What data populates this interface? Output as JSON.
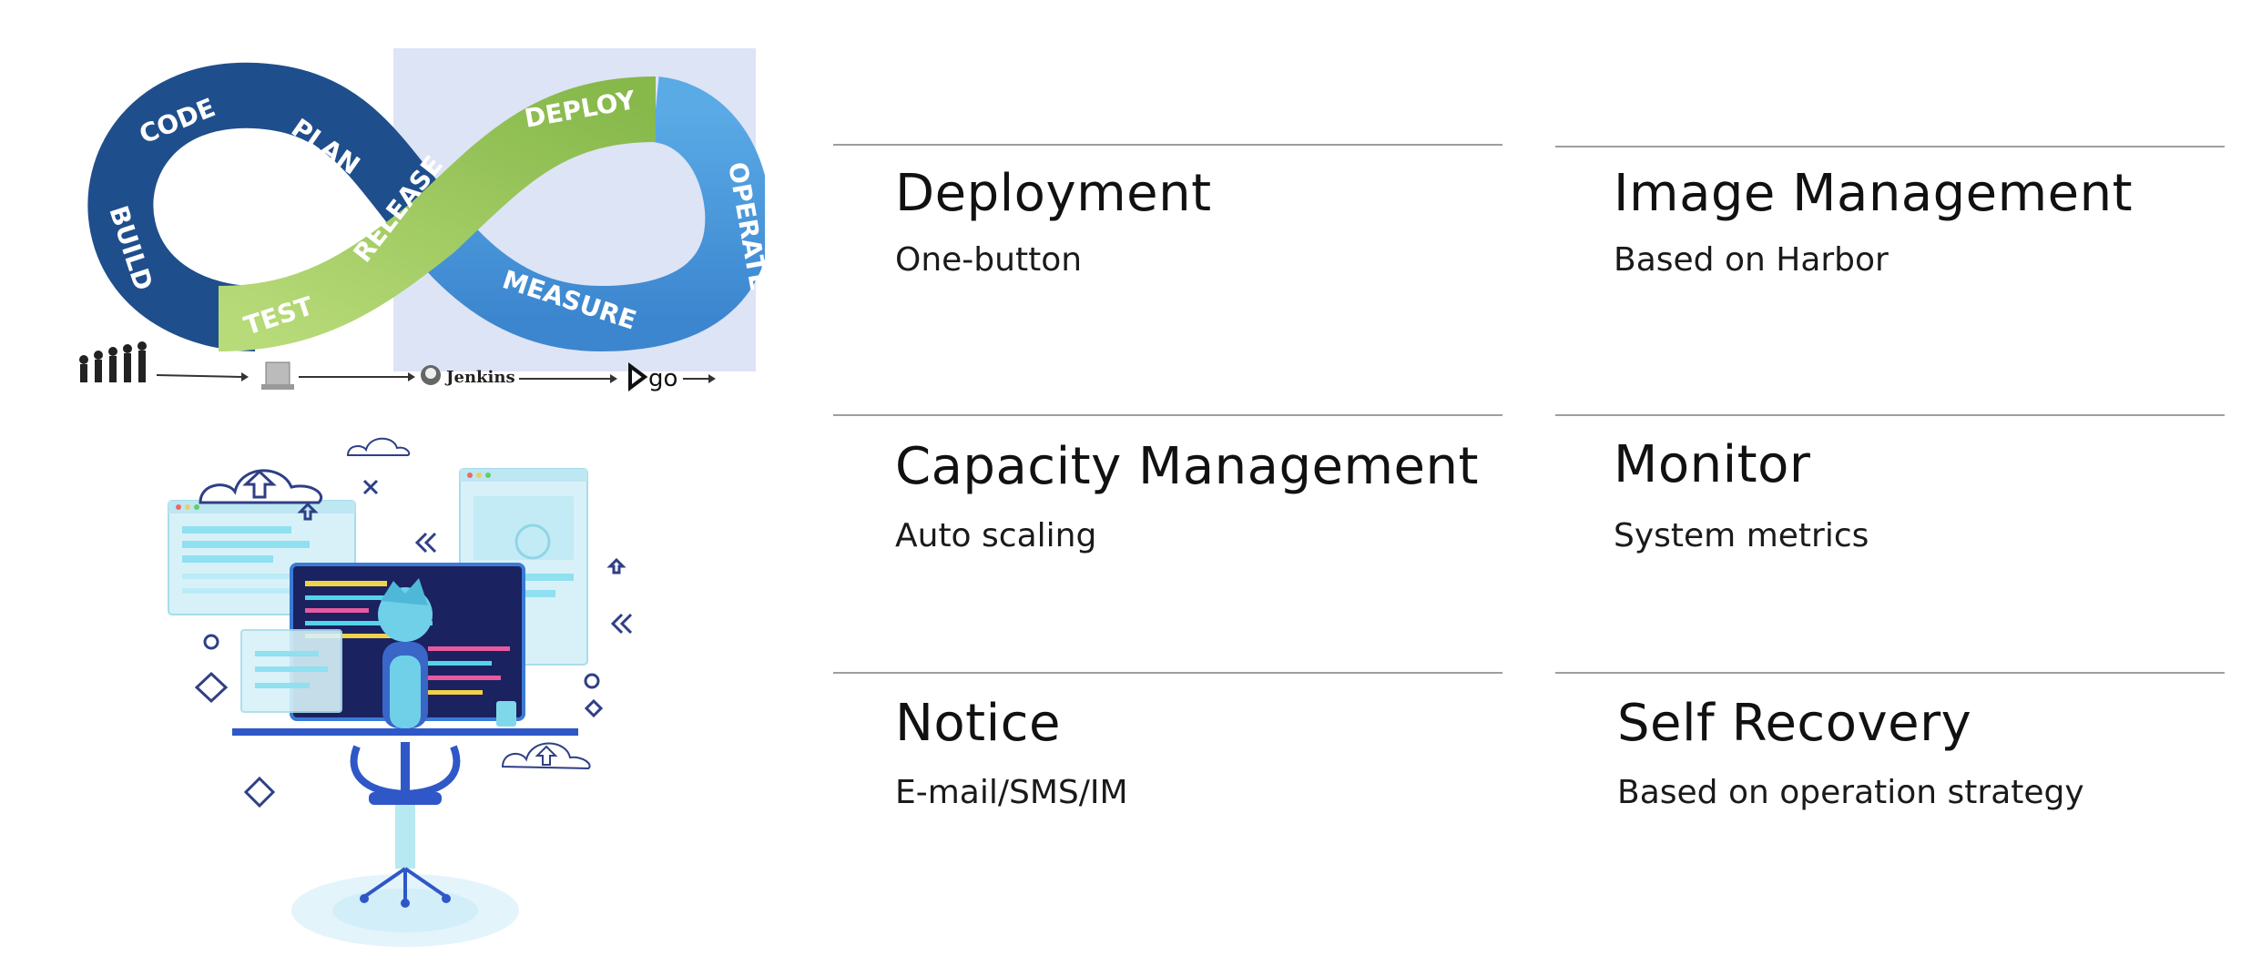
{
  "devops_loop": {
    "stages": [
      "CODE",
      "PLAN",
      "BUILD",
      "TEST",
      "RELEASE",
      "DEPLOY",
      "OPERATE",
      "MEASURE"
    ],
    "toolchain": [
      "Jenkins",
      "go"
    ],
    "colors": {
      "dark_blue": "#1f4e8c",
      "green": "#9cc85a",
      "light_blue": "#4f9ddf",
      "panel": "#dde4f5"
    }
  },
  "features": [
    {
      "title": "Deployment",
      "description": "One-button"
    },
    {
      "title": "Image Management",
      "description": "Based on Harbor"
    },
    {
      "title": "Capacity Management",
      "description": "Auto scaling"
    },
    {
      "title": "Monitor",
      "description": "System metrics"
    },
    {
      "title": "Notice",
      "description": "E-mail/SMS/IM"
    },
    {
      "title": "Self Recovery",
      "description": "Based on operation strategy"
    }
  ]
}
